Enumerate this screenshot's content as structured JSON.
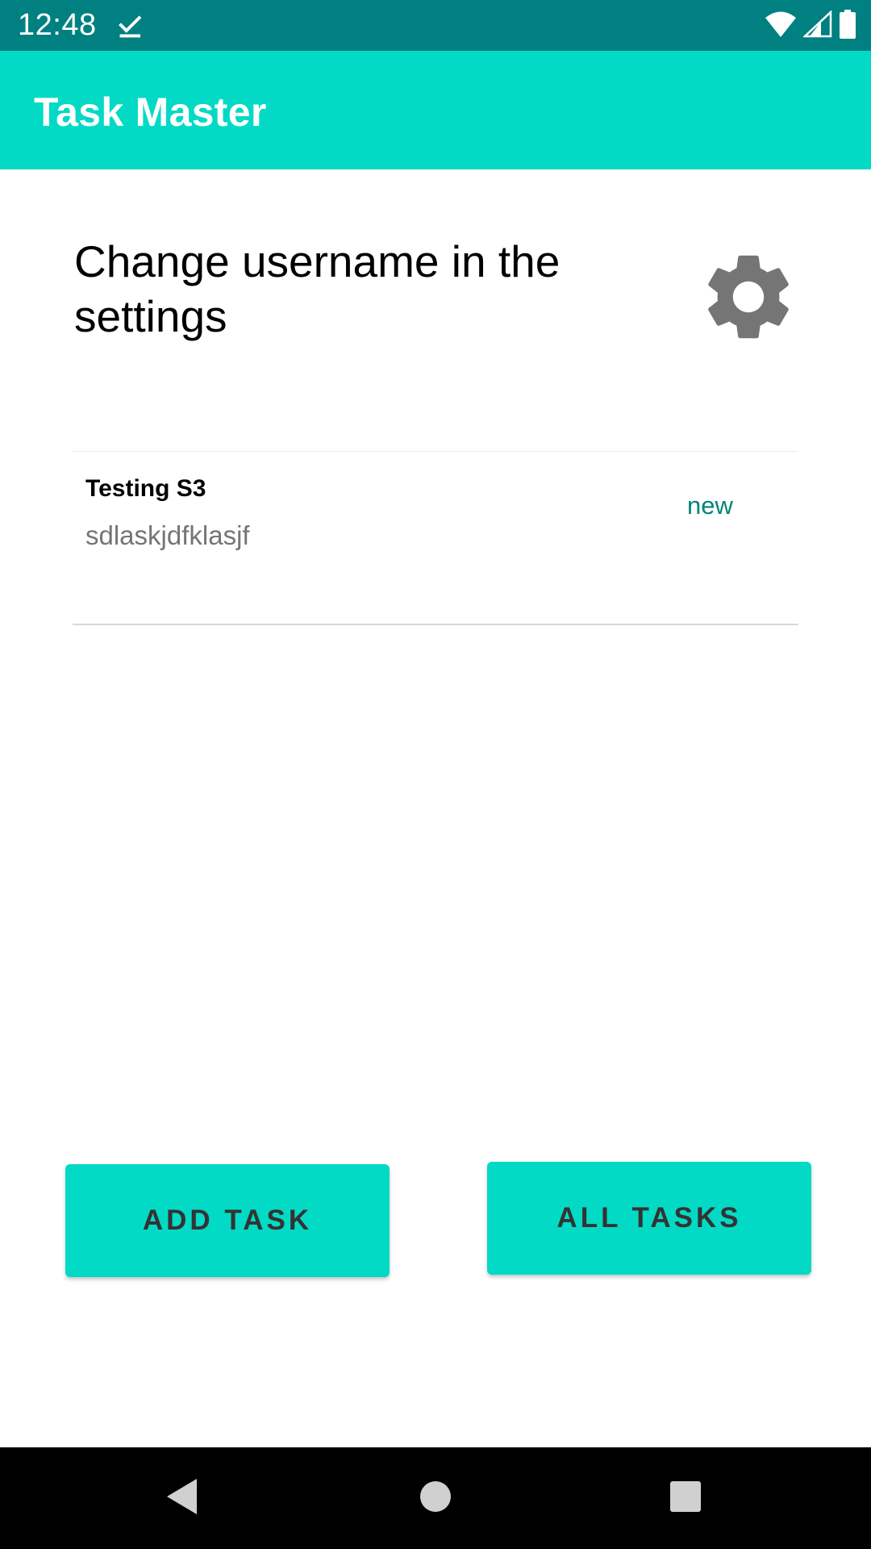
{
  "status_bar": {
    "time": "12:48",
    "notification_icon": "check-icon",
    "icons": [
      "wifi-icon",
      "signal-icon",
      "battery-icon"
    ]
  },
  "app_bar": {
    "title": "Task Master"
  },
  "main": {
    "greeting": "Change username in the settings",
    "settings_icon": "gear-icon",
    "tasks": [
      {
        "title": "Testing S3",
        "body": "sdlaskjdfklasjf",
        "state": "new"
      }
    ],
    "add_task_label": "ADD TASK",
    "all_tasks_label": "ALL TASKS"
  },
  "nav_bar": {
    "icons": [
      "back-icon",
      "home-icon",
      "recents-icon"
    ]
  },
  "colors": {
    "status_bar": "#008080",
    "app_bar": "#03dac5",
    "button": "#03dac5",
    "task_state": "#008577"
  }
}
